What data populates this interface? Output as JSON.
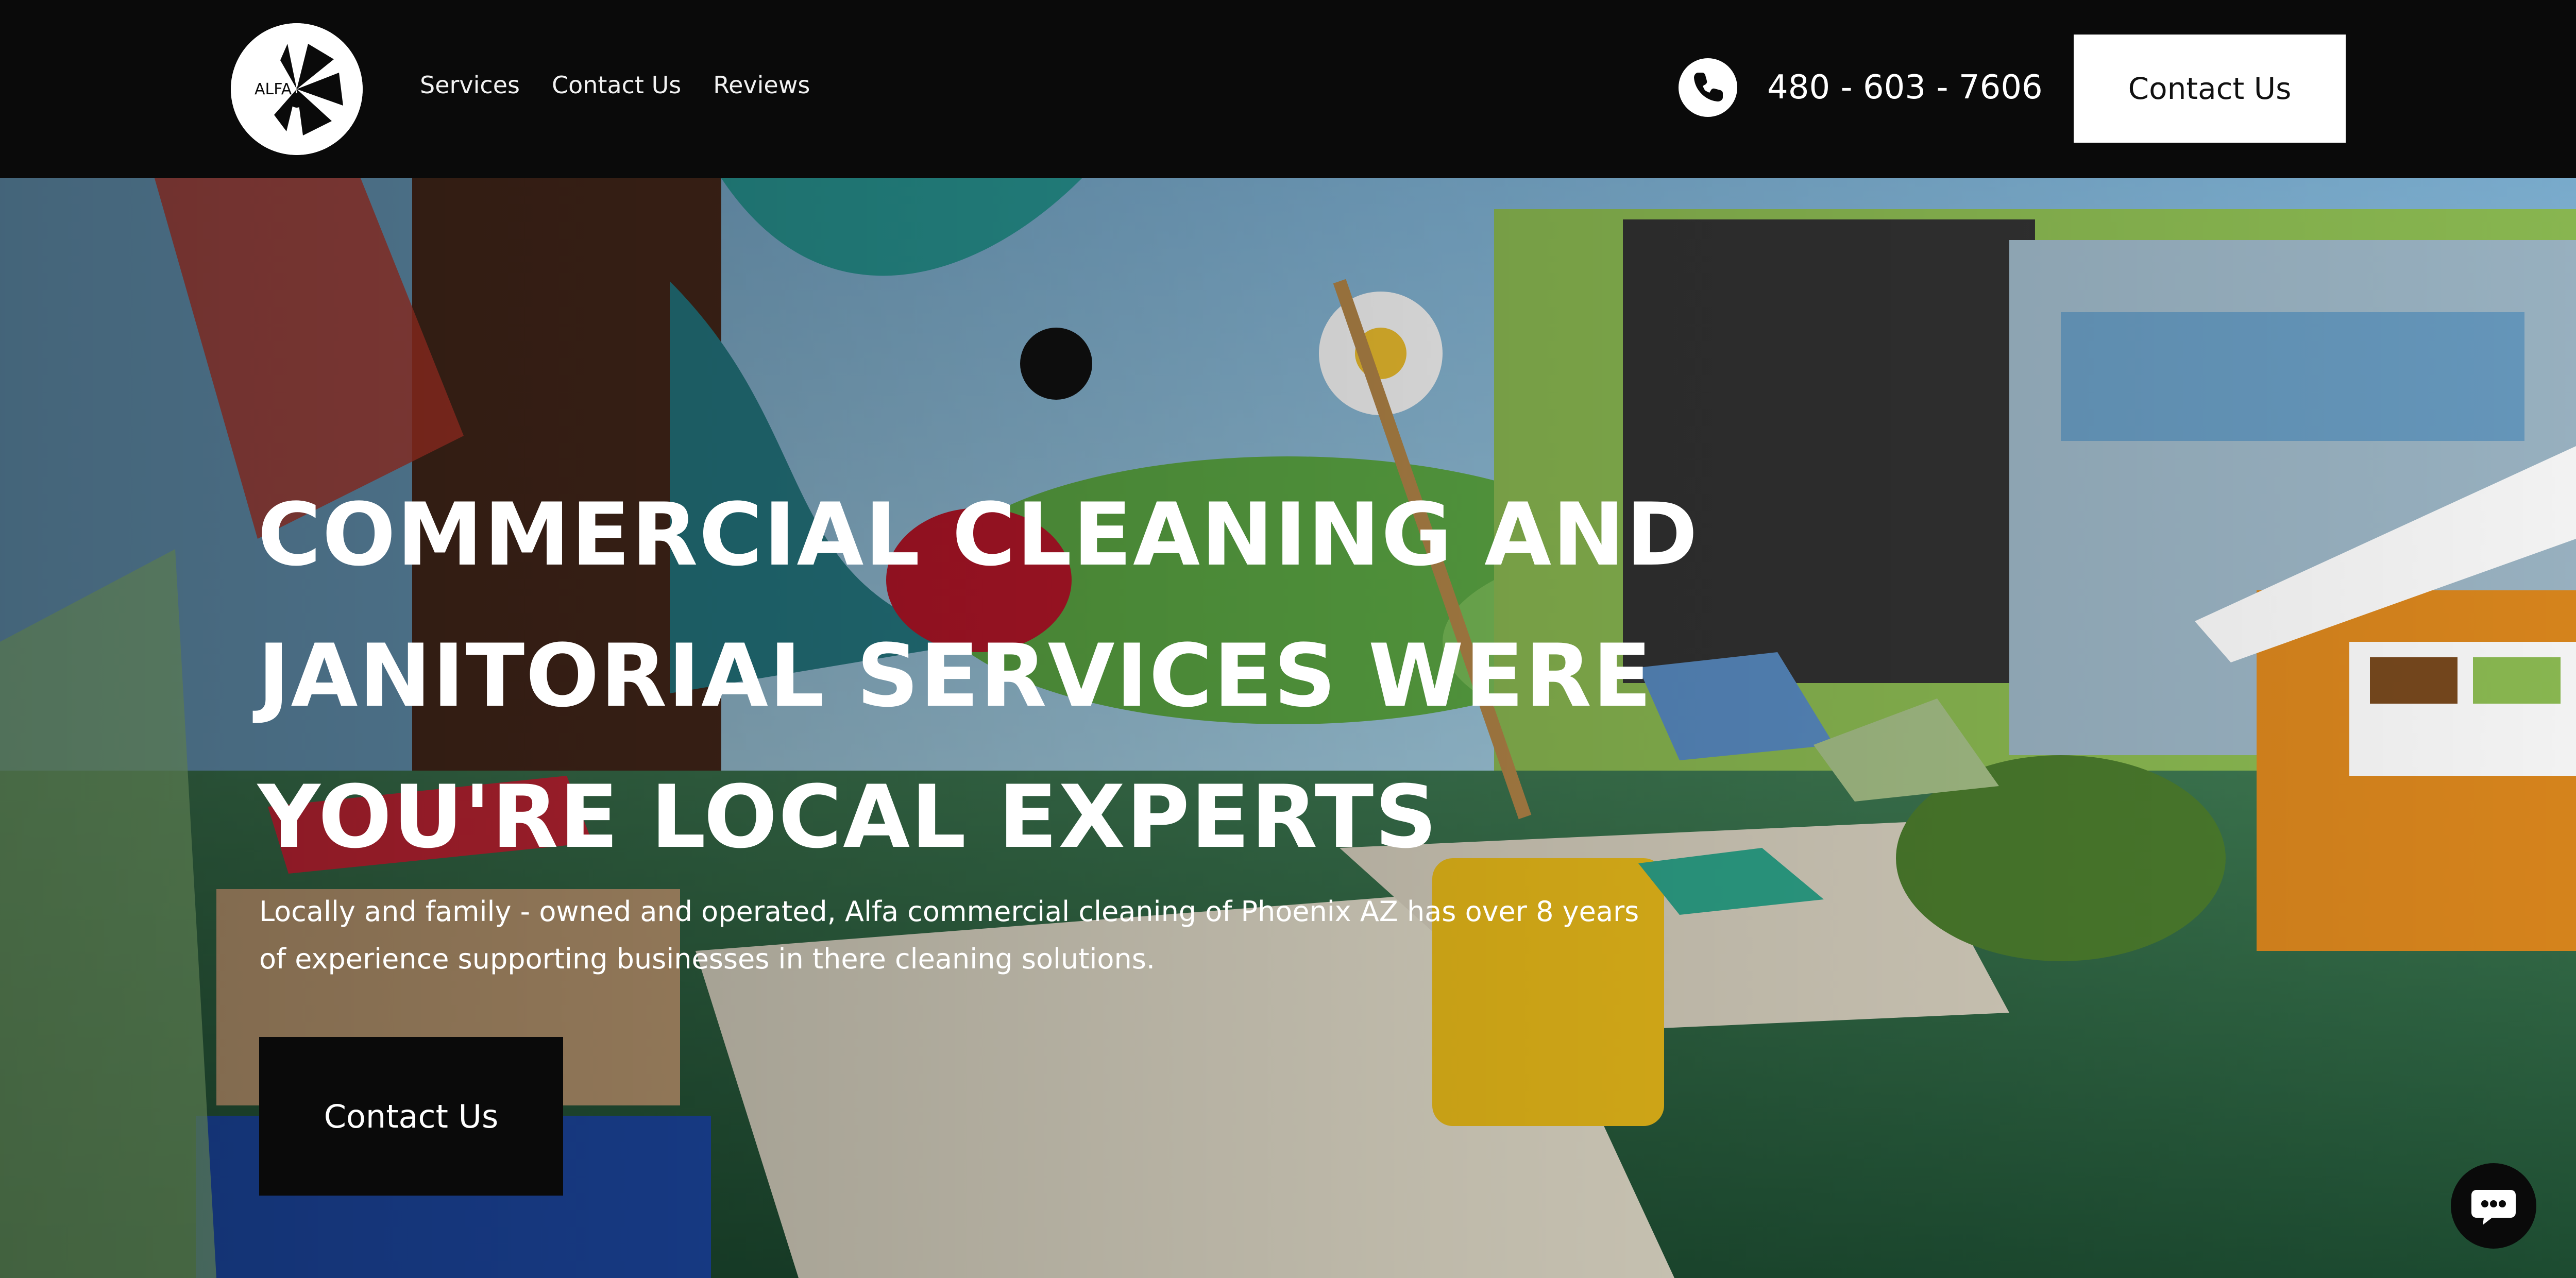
{
  "header": {
    "logo_text": "ALFA",
    "nav": [
      {
        "label": "Services"
      },
      {
        "label": "Contact Us"
      },
      {
        "label": "Reviews"
      }
    ],
    "phone_icon": "phone-icon",
    "phone": "480 - 603 - 7606",
    "cta_label": "Contact Us"
  },
  "hero": {
    "title_lines": [
      "COMMERCIAL CLEANING AND",
      "JANITORIAL SERVICES WERE",
      "YOU'RE LOCAL EXPERTS"
    ],
    "subtitle_lines": [
      "Locally and family - owned and operated, Alfa commercial cleaning of Phoenix AZ has over 8 years",
      "of experience supporting businesses in there cleaning solutions."
    ],
    "cta_label": "Contact Us",
    "background_image": "daycare-playroom-with-mop-bucket"
  },
  "chat": {
    "icon": "chat-bubble-icon"
  },
  "colors": {
    "header_bg": "#0a0a0a",
    "cta_bg": "#ffffff",
    "hero_cta_bg": "#0a0a0a",
    "text": "#ffffff"
  }
}
